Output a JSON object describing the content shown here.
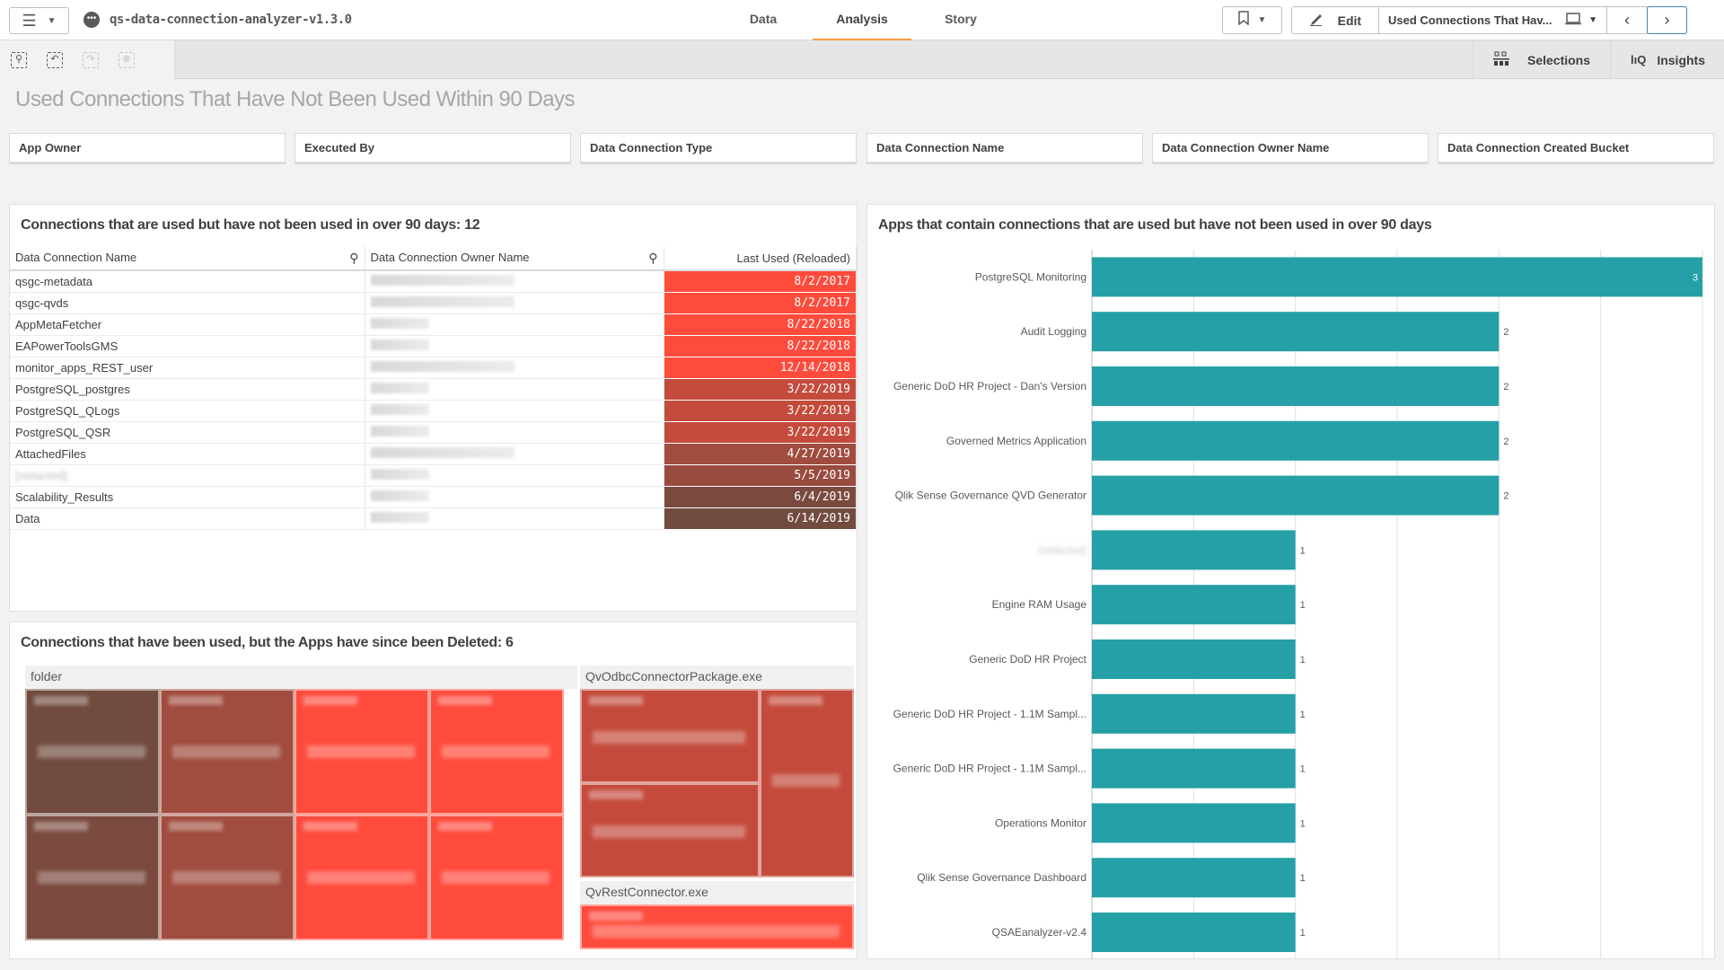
{
  "topbar": {
    "app_title": "qs-data-connection-analyzer-v1.3.0",
    "tabs": [
      {
        "label": "Data",
        "active": false
      },
      {
        "label": "Analysis",
        "active": true
      },
      {
        "label": "Story",
        "active": false
      }
    ],
    "edit_label": "Edit",
    "sheet_selector": "Used Connections That Hav...",
    "icons": {
      "menu": "hamburger-icon",
      "bookmark": "bookmark-icon",
      "edit": "pencil-icon",
      "prev": "chevron-left-icon",
      "next": "chevron-right-icon"
    }
  },
  "toolbar": {
    "selections_label": "Selections",
    "insights_label": "Insights"
  },
  "sheet": {
    "title": "Used Connections That Have Not Been Used Within 90 Days",
    "filters": [
      "App Owner",
      "Executed By",
      "Data Connection Type",
      "Data Connection Name",
      "Data Connection Owner Name",
      "Data Connection Created Bucket"
    ]
  },
  "table_panel": {
    "title": "Connections that are used but have not been used in over 90 days: 12",
    "columns": [
      "Data Connection Name",
      "Data Connection Owner Name",
      "Last Used (Reloaded)"
    ],
    "rows": [
      {
        "name": "qsgc-metadata",
        "owner": "[redacted]",
        "date": "8/2/2017",
        "color": "#ff4b3c"
      },
      {
        "name": "qsgc-qvds",
        "owner": "[redacted]",
        "date": "8/2/2017",
        "color": "#ff4b3c"
      },
      {
        "name": "AppMetaFetcher",
        "owner": "[redacted]",
        "date": "8/22/2018",
        "color": "#ff4b3c"
      },
      {
        "name": "EAPowerToolsGMS",
        "owner": "[redacted]",
        "date": "8/22/2018",
        "color": "#ff4b3c"
      },
      {
        "name": "monitor_apps_REST_user",
        "owner": "[redacted]",
        "date": "12/14/2018",
        "color": "#ff4b3c"
      },
      {
        "name": "PostgreSQL_postgres",
        "owner": "[redacted]",
        "date": "3/22/2019",
        "color": "#c44b3c"
      },
      {
        "name": "PostgreSQL_QLogs",
        "owner": "[redacted]",
        "date": "3/22/2019",
        "color": "#c44b3c"
      },
      {
        "name": "PostgreSQL_QSR",
        "owner": "[redacted]",
        "date": "3/22/2019",
        "color": "#c44b3c"
      },
      {
        "name": "AttachedFiles",
        "owner": "[redacted]",
        "date": "4/27/2019",
        "color": "#a04c3e"
      },
      {
        "name": "[redacted]",
        "owner": "[redacted]",
        "date": "5/5/2019",
        "color": "#994b3e"
      },
      {
        "name": "Scalability_Results",
        "owner": "[redacted]",
        "date": "6/4/2019",
        "color": "#7a4a3e"
      },
      {
        "name": "Data",
        "owner": "[redacted]",
        "date": "6/14/2019",
        "color": "#714b3e"
      }
    ]
  },
  "treemap_panel": {
    "title": "Connections that have been used, but the Apps have since been Deleted: 6",
    "groups": [
      {
        "label": "folder",
        "cells": [
          {
            "color": "#714b3e"
          },
          {
            "color": "#a04c3e"
          },
          {
            "color": "#ff4b3c"
          },
          {
            "color": "#ff4b3c"
          },
          {
            "color": "#7a4a3e"
          },
          {
            "color": "#a04c3e"
          },
          {
            "color": "#ff4b3c"
          },
          {
            "color": "#ff4b3c"
          }
        ]
      },
      {
        "label": "QvOdbcConnectorPackage.exe",
        "cells": [
          {
            "color": "#c44b3c"
          },
          {
            "color": "#c44b3c"
          },
          {
            "color": "#c44b3c"
          }
        ]
      },
      {
        "label": "QvRestConnector.exe",
        "cells": [
          {
            "color": "#ff4b3c"
          }
        ]
      }
    ]
  },
  "chart_data": {
    "type": "bar",
    "orientation": "horizontal",
    "title": "Apps that contain connections that are used but have not been used in over 90 days",
    "categories": [
      "PostgreSQL Monitoring",
      "Audit Logging",
      "Generic DoD HR Project - Dan's Version",
      "Governed Metrics Application",
      "Qlik Sense Governance QVD Generator",
      "[redacted]",
      "Engine RAM Usage",
      "Generic DoD HR Project",
      "Generic DoD HR Project - 1.1M Sampl...",
      "Generic DoD HR Project - 1.1M Sampl...",
      "Operations Monitor",
      "Qlik Sense Governance Dashboard",
      "QSAEanalyzer-v2.4"
    ],
    "values": [
      3,
      2,
      2,
      2,
      2,
      1,
      1,
      1,
      1,
      1,
      1,
      1,
      1
    ],
    "xlim": [
      0,
      3
    ],
    "grid": true,
    "bar_color": "#25a0a6",
    "data_labels": true
  }
}
